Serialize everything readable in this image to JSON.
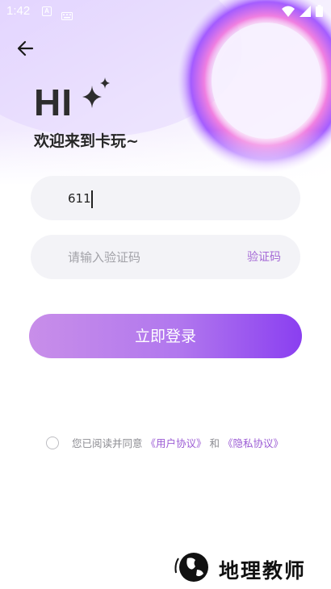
{
  "status_bar": {
    "time": "1:42"
  },
  "header": {
    "hi_text": "HI",
    "welcome_text": "欢迎来到卡玩~"
  },
  "form": {
    "phone_value": "611",
    "code_placeholder": "请输入验证码",
    "code_button_label": "验证码",
    "login_button_label": "立即登录"
  },
  "agreement": {
    "prefix": "您已阅读并同意 ",
    "user_agreement": "《用户协议》",
    "conjunction": " 和 ",
    "privacy_policy": "《隐私协议》",
    "checked": false
  },
  "watermark": {
    "text": "地理教师"
  },
  "colors": {
    "accent": "#9b5bd4",
    "button_start": "#c88ee9",
    "button_end": "#8a3ff0"
  }
}
